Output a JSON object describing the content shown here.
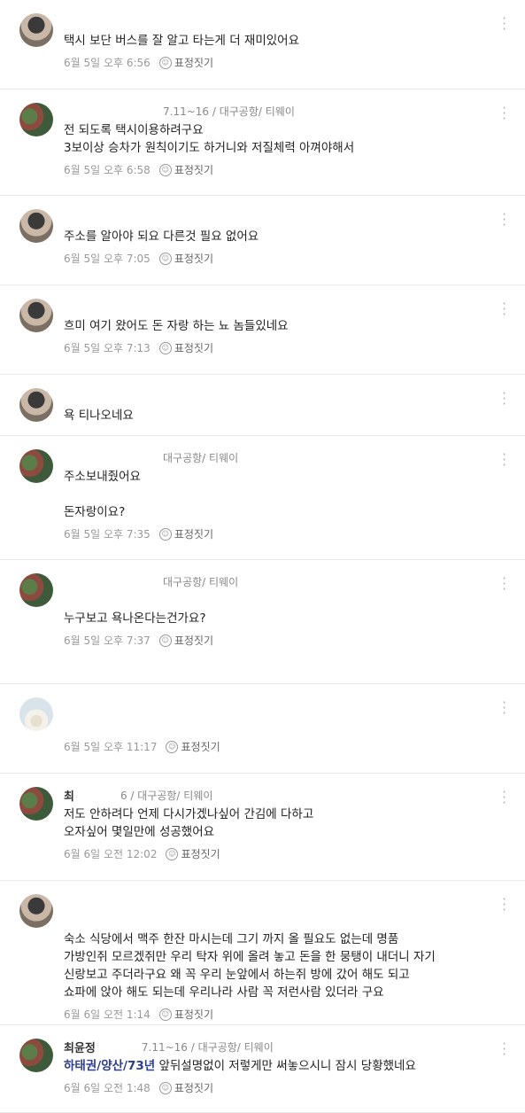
{
  "reaction_label": "표정짓기",
  "comments": [
    {
      "author": "",
      "info": "",
      "body": [
        "택시 보단 버스를 잘 알고 타는게 더 재미있어요"
      ],
      "tag": "",
      "time": "6월 5일 오후 6:56",
      "avatar": "p1"
    },
    {
      "author": "",
      "info": "7.11~16 / 대구공항/ 티웨이",
      "body": [
        "전 되도록 택시이용하려구요",
        "3보이상 승차가 원칙이기도 하거니와 저질체력 아껴야해서"
      ],
      "tag": "",
      "time": "6월 5일 오후 6:58",
      "avatar": "p2"
    },
    {
      "author": "",
      "info": "",
      "body": [
        "주소를 알아야 되요 다른것 필요 없어요"
      ],
      "tag": "",
      "time": "6월 5일 오후 7:05",
      "avatar": "p1"
    },
    {
      "author": "",
      "info": "",
      "body": [
        "흐미 여기 왔어도 돈 자랑 하는 뇨 놈들있네요"
      ],
      "tag": "",
      "time": "6월 5일 오후 7:13",
      "avatar": "p1"
    },
    {
      "author": "",
      "info": "",
      "body": [
        "욕 티나오네요"
      ],
      "tag": "",
      "time": "",
      "avatar": "p1"
    },
    {
      "author": "",
      "info": "대구공항/ 티웨이",
      "body": [
        "주소보내줬어요",
        "",
        "돈자랑이요?"
      ],
      "tag": "",
      "time": "6월 5일 오후 7:35",
      "avatar": "p2"
    },
    {
      "author": "",
      "info": "대구공항/ 티웨이",
      "body": [
        "",
        "누구보고 욕나온다는건가요?"
      ],
      "tag": "",
      "time": "6월 5일 오후 7:37",
      "avatar": "p2"
    },
    {
      "author": "",
      "info": "",
      "body": [
        ""
      ],
      "tag": "",
      "time": "6월 5일 오후 11:17",
      "avatar": "p3"
    },
    {
      "author": "최",
      "info": "6 / 대구공항/ 티웨이",
      "body": [
        "저도 안하려다 언제 다시가겠나싶어 간김에 다하고",
        "오자싶어 몇일만에 성공했어요"
      ],
      "tag": "",
      "time": "6월 6일 오전 12:02",
      "avatar": "p2"
    },
    {
      "author": "",
      "info": "",
      "body": [
        "",
        "숙소 식당에서 맥주 한잔 마시는데 그기 까지 올 필요도 없는데 명품",
        "가방인쥐 모르겠쥐만 우리 탁자 위에 올려 놓고 돈을 한 뭉탱이 내더니 자기",
        "신랑보고 주더라구요 왜 꼭 우리 눈앞에서 하는쥐 방에 갔어 해도 되고",
        "쇼파에 앉아 해도 되는데 우리나라 사람 꼭 저런사람 있더라 구요"
      ],
      "tag": "",
      "time": "6월 6일 오전 1:14",
      "avatar": "p1"
    },
    {
      "author": "최윤정",
      "info": "7.11~16 / 대구공항/ 티웨이",
      "body": [
        "앞뒤설명없이 저렇게만 써놓으시니 잠시 당황했네요"
      ],
      "tag": "하태권/양산/73년",
      "time": "6월 6일 오전 1:48",
      "avatar": "p2"
    }
  ]
}
